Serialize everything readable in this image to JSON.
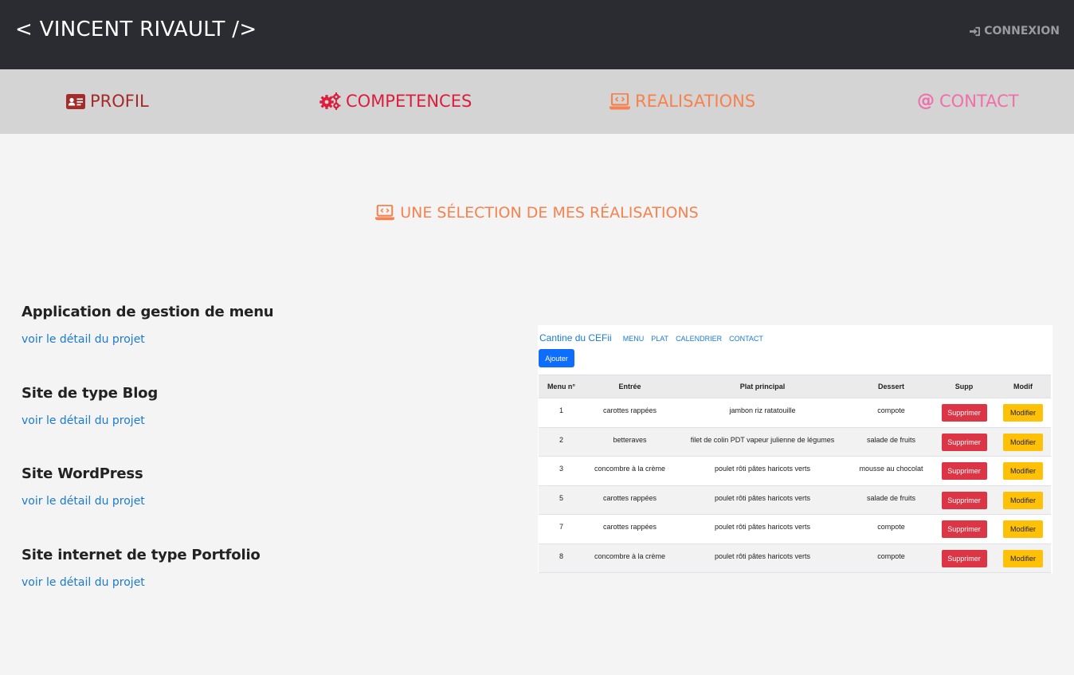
{
  "header": {
    "brand": "< VINCENT RIVAULT />",
    "login_label": "CONNEXION",
    "login_icon": "sign-in-icon"
  },
  "nav": {
    "items": [
      {
        "label": "PROFIL",
        "icon": "id-card-icon",
        "color": "#a52a2a"
      },
      {
        "label": "COMPETENCES",
        "icon": "cogs-icon",
        "color": "#dc1e3c"
      },
      {
        "label": "REALISATIONS",
        "icon": "laptop-code-icon",
        "color": "#f5824f"
      },
      {
        "label": "CONTACT",
        "icon": "at-icon",
        "color": "#f06ea9"
      }
    ]
  },
  "section": {
    "title": "UNE SÉLECTION DE MES RÉALISATIONS",
    "icon": "laptop-code-icon",
    "color": "#f5824f"
  },
  "projects": [
    {
      "title": "Application de gestion de menu",
      "link": "voir le détail du projet"
    },
    {
      "title": "Site de type Blog",
      "link": "voir le détail du projet"
    },
    {
      "title": "Site WordPress",
      "link": "voir le détail du projet"
    },
    {
      "title": "Site internet de type Portfolio",
      "link": "voir le détail du projet"
    }
  ],
  "screenshot": {
    "brand": "Cantine du CEFii",
    "links": [
      "MENU",
      "PLAT",
      "CALENDRIER",
      "CONTACT"
    ],
    "add_button": "Ajouter",
    "columns": [
      "Menu n°",
      "Entrée",
      "Plat principal",
      "Dessert",
      "Supp",
      "Modif"
    ],
    "delete_label": "Supprimer",
    "edit_label": "Modifier",
    "rows": [
      {
        "num": "1",
        "entree": "carottes rappées",
        "plat": "jambon riz ratatouille",
        "dessert": "compote"
      },
      {
        "num": "2",
        "entree": "betteraves",
        "plat": "filet de colin PDT vapeur julienne de légumes",
        "dessert": "salade de fruits"
      },
      {
        "num": "3",
        "entree": "concombre à la crème",
        "plat": "poulet rôti pâtes haricots verts",
        "dessert": "mousse au chocolat"
      },
      {
        "num": "5",
        "entree": "carottes rappées",
        "plat": "poulet rôti pâtes haricots verts",
        "dessert": "salade de fruits"
      },
      {
        "num": "7",
        "entree": "carottes rappées",
        "plat": "poulet rôti pâtes haricots verts",
        "dessert": "compote"
      },
      {
        "num": "8",
        "entree": "concombre à la crème",
        "plat": "poulet rôti pâtes haricots verts",
        "dessert": "compote"
      }
    ]
  }
}
